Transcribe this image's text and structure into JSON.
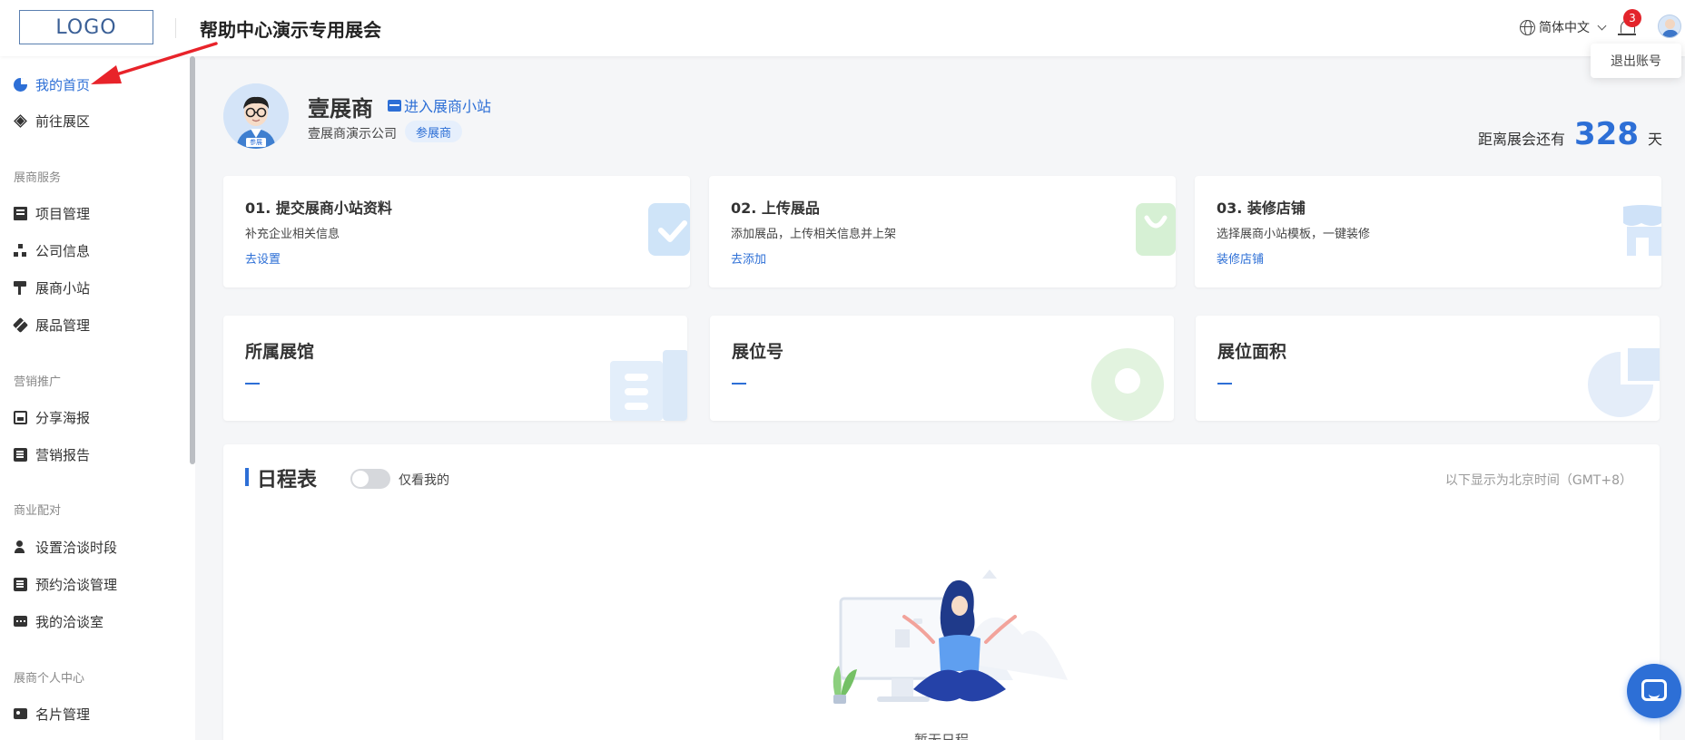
{
  "header": {
    "logo": "LOGO",
    "title": "帮助中心演示专用展会",
    "language": "简体中文",
    "notification_count": "3",
    "logout": "退出账号"
  },
  "sidebar": {
    "items": [
      {
        "label": "我的首页",
        "icon": "pie-chart-icon",
        "active": true
      },
      {
        "label": "前往展区",
        "icon": "layers-icon"
      }
    ],
    "groups": [
      {
        "title": "展商服务",
        "items": [
          "项目管理",
          "公司信息",
          "展商小站",
          "展品管理"
        ]
      },
      {
        "title": "营销推广",
        "items": [
          "分享海报",
          "营销报告"
        ]
      },
      {
        "title": "商业配对",
        "items": [
          "设置洽谈时段",
          "预约洽谈管理",
          "我的洽谈室"
        ]
      },
      {
        "title": "展商个人中心",
        "items": [
          "名片管理"
        ]
      }
    ]
  },
  "profile": {
    "name": "壹展商",
    "enter_link": "进入展商小站",
    "company": "壹展商演示公司",
    "role": "参展商",
    "avatar_tag": "参展"
  },
  "countdown": {
    "prefix": "距离展会还有",
    "days": "328",
    "suffix": "天"
  },
  "steps": [
    {
      "title": "01. 提交展商小站资料",
      "desc": "补充企业相关信息",
      "link": "去设置"
    },
    {
      "title": "02. 上传展品",
      "desc": "添加展品，上传相关信息并上架",
      "link": "去添加"
    },
    {
      "title": "03. 装修店铺",
      "desc": "选择展商小站模板，一键装修",
      "link": "装修店铺"
    }
  ],
  "info": [
    {
      "title": "所属展馆"
    },
    {
      "title": "展位号"
    },
    {
      "title": "展位面积"
    }
  ],
  "schedule": {
    "title": "日程表",
    "toggle_label": "仅看我的",
    "timezone": "以下显示为北京时间（GMT+8）",
    "empty": "暂无日程"
  },
  "colors": {
    "accent": "#2d6fd6",
    "badge": "#e3242b"
  }
}
